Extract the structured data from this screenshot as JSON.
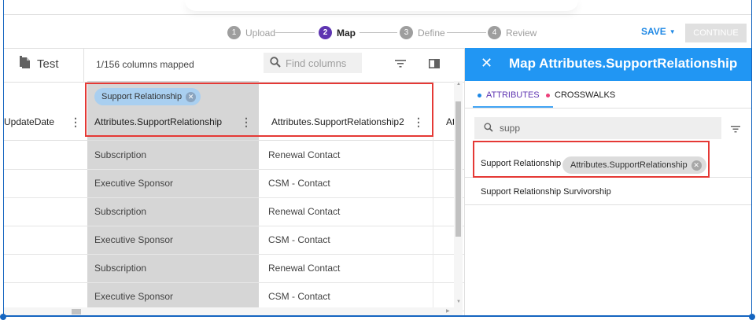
{
  "stepper": {
    "steps": [
      {
        "num": "1",
        "label": "Upload"
      },
      {
        "num": "2",
        "label": "Map"
      },
      {
        "num": "3",
        "label": "Define"
      },
      {
        "num": "4",
        "label": "Review"
      }
    ],
    "save_label": "SAVE",
    "continue_label": "CONTINUE"
  },
  "toolbar": {
    "dataset_name": "Test",
    "mapped_status": "1/156 columns mapped",
    "search_placeholder": "Find columns"
  },
  "grid": {
    "columns": [
      {
        "label": "UpdateDate"
      },
      {
        "label": "Attributes.SupportRelationship",
        "chip": "Support Relationship"
      },
      {
        "label": "Attributes.SupportRelationship2"
      },
      {
        "label": "At"
      }
    ],
    "rows": [
      [
        "",
        "Subscription",
        "Renewal Contact"
      ],
      [
        "",
        "Executive Sponsor",
        "CSM - Contact"
      ],
      [
        "",
        "Subscription",
        "Renewal Contact"
      ],
      [
        "",
        "Executive Sponsor",
        "CSM - Contact"
      ],
      [
        "",
        "Subscription",
        "Renewal Contact"
      ],
      [
        "",
        "Executive Sponsor",
        "CSM - Contact"
      ]
    ]
  },
  "panel": {
    "title": "Map Attributes.SupportRelationship",
    "tabs": [
      "ATTRIBUTES",
      "CROSSWALKS"
    ],
    "search_value": "supp",
    "results": [
      {
        "label": "Support Relationship",
        "chip": "Attributes.SupportRelationship"
      },
      {
        "label": "Support Relationship Survivorship"
      }
    ]
  },
  "colors": {
    "accent_blue": "#2196f3",
    "step_active": "#5e35b1",
    "highlight_red": "#e53935",
    "selected_column": "#d6d6d6"
  }
}
